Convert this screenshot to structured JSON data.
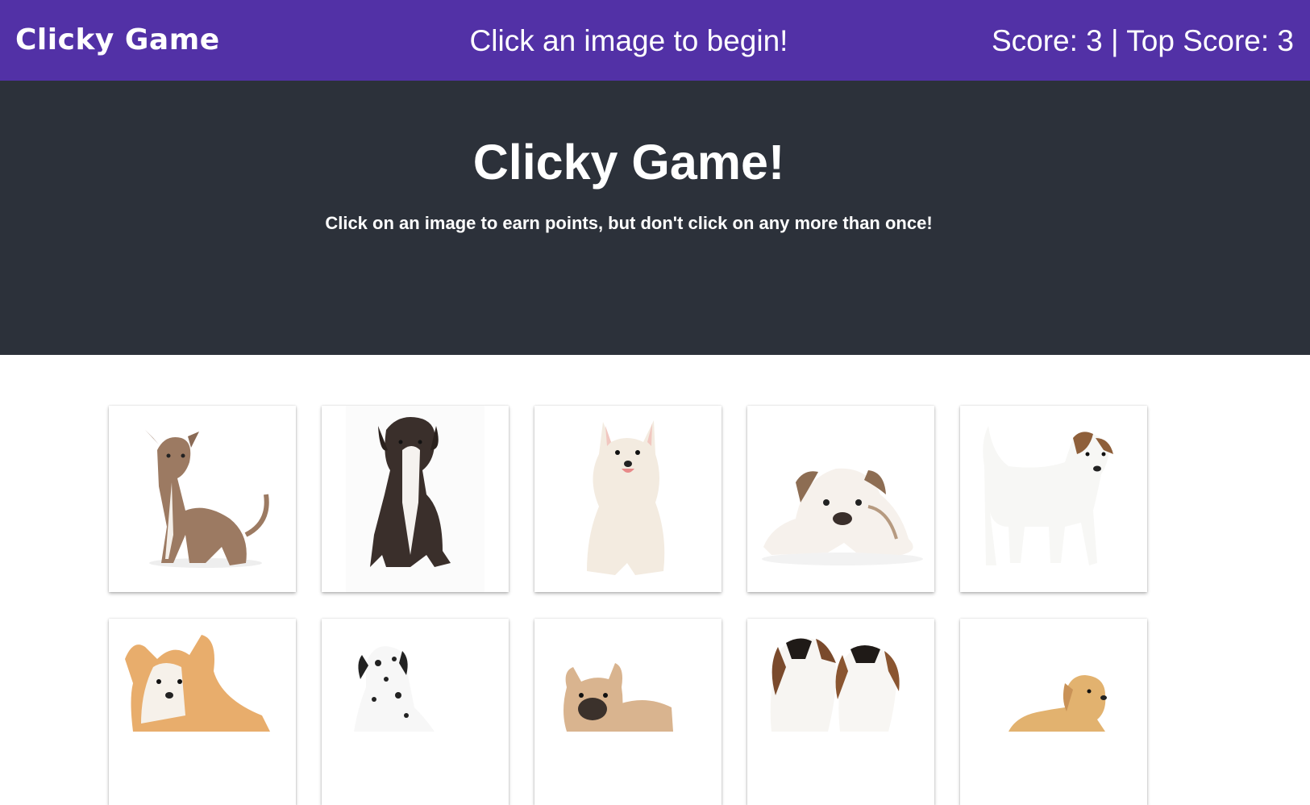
{
  "navbar": {
    "brand": "Clicky Game",
    "status": "Click an image to begin!",
    "score_text": "Score: 3 | Top Score: 3"
  },
  "jumbotron": {
    "title": "Clicky Game!",
    "subtitle": "Click on an image to earn points, but don't click on any more than once!"
  },
  "colors": {
    "navbar_bg": "#5231a6",
    "jumbotron_bg": "#2c313a"
  },
  "cards": [
    {
      "name": "brindle-pitbull-puppy-image"
    },
    {
      "name": "boxer-puppy-image"
    },
    {
      "name": "white-spitz-puppy-image"
    },
    {
      "name": "bulldog-puppy-image"
    },
    {
      "name": "jack-russell-puppy-image"
    },
    {
      "name": "corgi-puppy-image"
    },
    {
      "name": "dalmatian-puppy-image"
    },
    {
      "name": "french-bulldog-puppy-image"
    },
    {
      "name": "beagle-puppies-image"
    },
    {
      "name": "golden-retriever-puppy-image"
    }
  ]
}
